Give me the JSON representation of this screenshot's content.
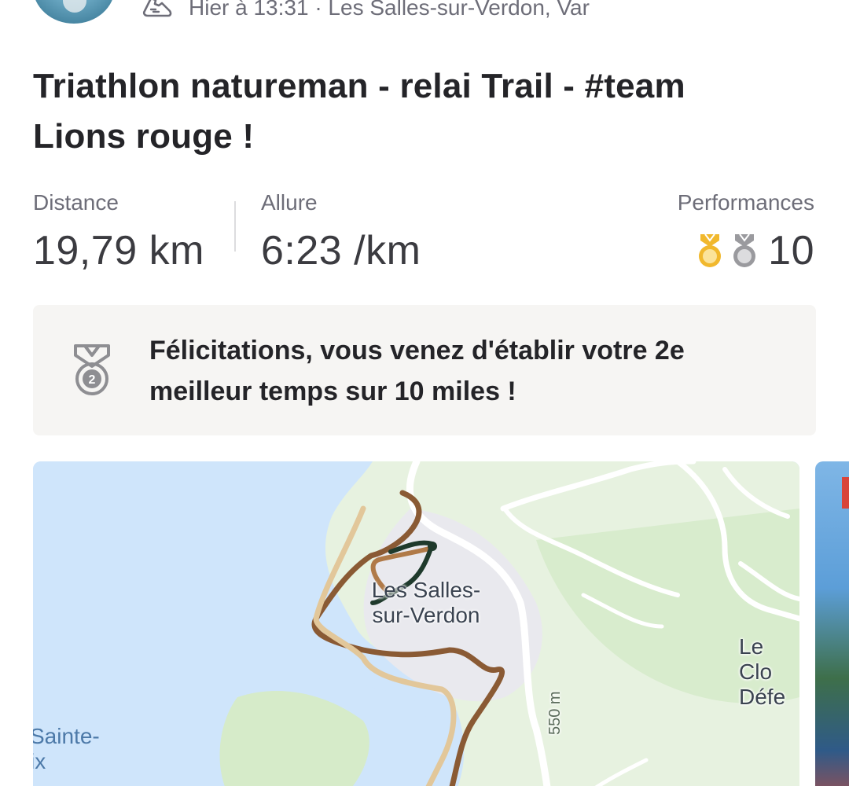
{
  "header": {
    "activity_icon": "running-shoe-icon",
    "meta": "Hier à 13:31 · Les Salles-sur-Verdon, Var"
  },
  "title": "Triathlon natureman - relai Trail - #team Lions rouge !",
  "stats": {
    "distance": {
      "label": "Distance",
      "value": "19,79 km"
    },
    "pace": {
      "label": "Allure",
      "value": "6:23 /km"
    },
    "performances": {
      "label": "Performances",
      "value": "10",
      "icons": [
        "gold-medal-icon",
        "silver-medal-icon"
      ]
    }
  },
  "achievement": {
    "icon": "silver-medal-2-icon",
    "message": "Félicitations, vous venez d'établir votre 2e meilleur temps sur 10 miles !",
    "medal_number": "2"
  },
  "map": {
    "labels": {
      "town": "Les Salles-\nsur-Verdon",
      "clos": "Le Clo\nDéfe",
      "sainte": "Sainte-\nix",
      "altitude": "550 m"
    },
    "colors": {
      "water": "#cfe5fb",
      "land": "#e7f2e0",
      "route_dark": "#1f3a2c",
      "route_brown": "#8a5a34",
      "route_light": "#e2c79a"
    }
  },
  "colors": {
    "gold": "#f1b82d",
    "silver": "#9a9a9e",
    "text": "#242428",
    "muted": "#6d6d78"
  }
}
